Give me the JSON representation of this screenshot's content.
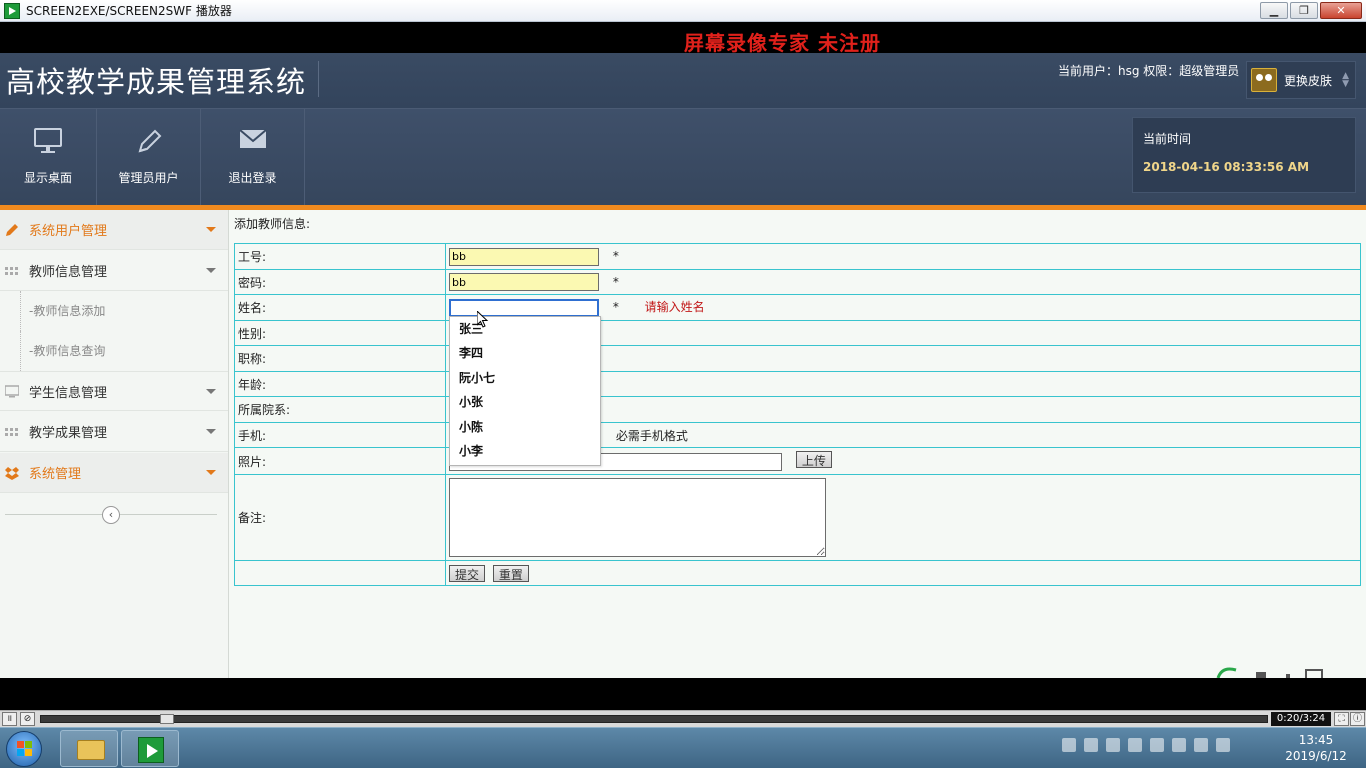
{
  "window": {
    "title": "SCREEN2EXE/SCREEN2SWF 播放器",
    "minimize": "▁",
    "maximize": "❐",
    "close": "✕"
  },
  "watermark": "屏幕录像专家  未注册",
  "header": {
    "system_title": "高校教学成果管理系统",
    "user_info": "当前用户：hsg  权限：超级管理员",
    "skin_label": "更换皮肤"
  },
  "toolbar": {
    "items": [
      {
        "label": "显示桌面",
        "icon": "monitor-icon"
      },
      {
        "label": "管理员用户",
        "icon": "pencil-icon"
      },
      {
        "label": "退出登录",
        "icon": "envelope-icon"
      }
    ],
    "time_label": "当前时间",
    "time_value": "2018-04-16 08:33:56 AM"
  },
  "sidebar": {
    "items": [
      {
        "label": "系统用户管理",
        "icon": "pencil-icon",
        "active": true
      },
      {
        "label": "教师信息管理",
        "icon": "grid-icon"
      },
      {
        "label": "教师信息添加",
        "sub": true
      },
      {
        "label": "教师信息查询",
        "sub": true
      },
      {
        "label": "学生信息管理",
        "icon": "monitor-icon"
      },
      {
        "label": "教学成果管理",
        "icon": "grid-icon"
      },
      {
        "label": "系统管理",
        "icon": "dropbox-icon",
        "active": true
      }
    ],
    "collapse_glyph": "‹"
  },
  "form": {
    "title": "添加教师信息:",
    "labels": {
      "id": "工号:",
      "password": "密码:",
      "name": "姓名:",
      "gender": "性别:",
      "title": "职称:",
      "age": "年龄:",
      "department": "所属院系:",
      "phone": "手机:",
      "photo": "照片:",
      "remark": "备注:"
    },
    "values": {
      "id": "bb",
      "password": "bb",
      "name": ""
    },
    "required_mark": "*",
    "name_error": "请输入姓名",
    "phone_hint": "必需手机格式",
    "upload_button": "上传",
    "submit_button": "提交",
    "reset_button": "重置",
    "autocomplete": [
      "张三",
      "李四",
      "阮小七",
      "小张",
      "小陈",
      "小李"
    ]
  },
  "player": {
    "pause": "॥",
    "stop": "⊘",
    "time": "0:20/3:24",
    "progress_fraction": 0.098
  },
  "taskbar": {
    "clock_time": "13:45",
    "clock_date": "2019/6/12"
  },
  "colors": {
    "header_bg": "#3a4b63",
    "accent_orange": "#f08a1f",
    "table_border": "#39c4ce",
    "watermark_red": "#e0211b",
    "time_gold": "#f0d68a"
  }
}
